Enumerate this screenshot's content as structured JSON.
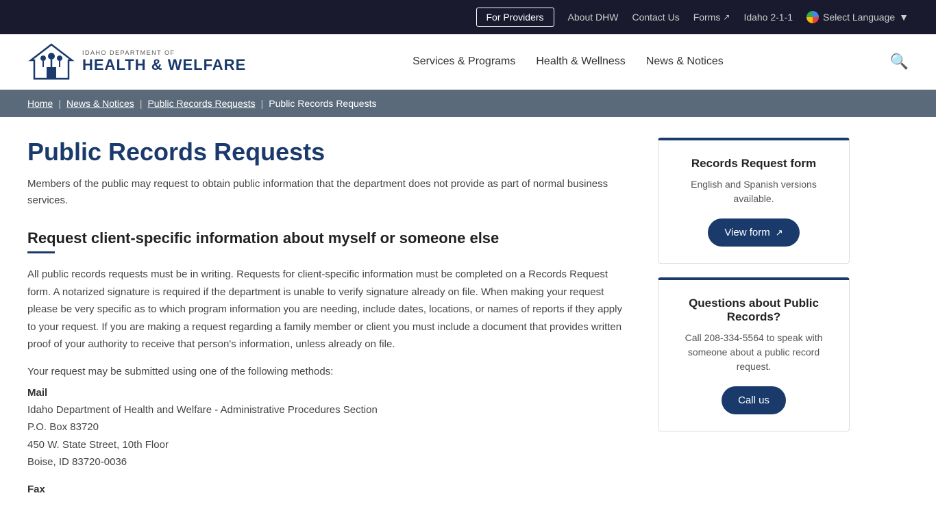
{
  "topbar": {
    "for_providers_label": "For Providers",
    "about_dhw_label": "About DHW",
    "contact_us_label": "Contact Us",
    "forms_label": "Forms",
    "idaho_211_label": "Idaho 2-1-1",
    "select_language_label": "Select Language"
  },
  "header": {
    "logo_subtitle": "Idaho Department of",
    "logo_title": "HEALTH & WELFARE",
    "nav": {
      "services_programs": "Services & Programs",
      "health_wellness": "Health & Wellness",
      "news_notices": "News & Notices"
    }
  },
  "breadcrumb": {
    "home": "Home",
    "news_notices": "News & Notices",
    "public_records_1": "Public Records Requests",
    "public_records_2": "Public Records Requests"
  },
  "main": {
    "page_title": "Public Records Requests",
    "page_subtitle": "Members of the public may request to obtain public information that the department does not provide as part of normal business services.",
    "section_heading": "Request client-specific information about myself or someone else",
    "body_text": "All public records requests must be in writing. Requests for client-specific information must be completed on a Records Request form. A notarized signature is required if the department is unable to verify signature already on file. When making your request please be very specific as to which program information you are needing, include dates, locations, or names of reports if they apply to your request. If you are making a request regarding a family member or client you must include a document that provides written proof of your authority to receive that person's information, unless already on file.",
    "submit_text": "Your request may be submitted using one of the following methods:",
    "mail_label": "Mail",
    "mail_line1": "Idaho Department of Health and Welfare - Administrative Procedures Section",
    "mail_line2": "P.O. Box 83720",
    "mail_line3": "450 W. State Street, 10th Floor",
    "mail_line4": "Boise, ID 83720-0036",
    "fax_label": "Fax"
  },
  "sidebar": {
    "card1": {
      "title": "Records Request form",
      "subtitle": "English and Spanish versions available.",
      "btn_label": "View form"
    },
    "card2": {
      "title": "Questions about Public Records?",
      "subtitle": "Call 208-334-5564 to speak with someone about a public record request.",
      "btn_label": "Call us"
    }
  }
}
